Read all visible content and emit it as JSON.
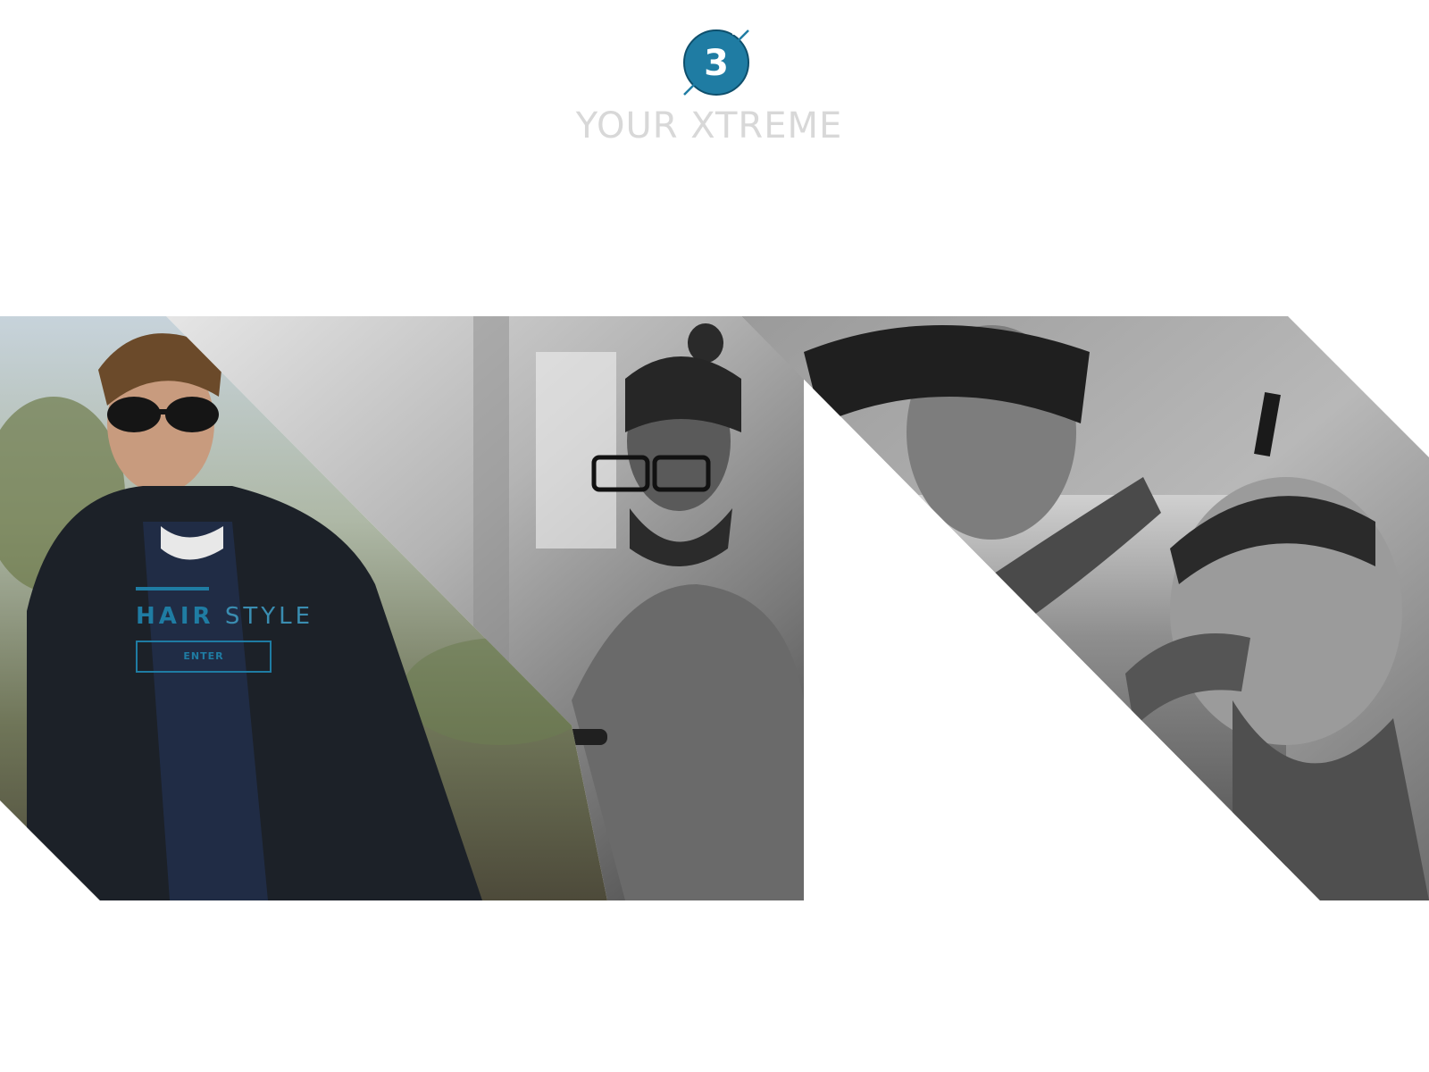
{
  "brand": {
    "logo_number": "3",
    "logo_icon": "circle-number-logo",
    "title": "YOUR XTREME"
  },
  "hero": {
    "panels": [
      {
        "subject": "man-leather-jacket-sunglasses",
        "style": "color"
      },
      {
        "subject": "man-bun-glasses-beard",
        "style": "grayscale"
      },
      {
        "subject": "barber-styling-bearded-client",
        "style": "grayscale"
      }
    ],
    "overlay": {
      "title_bold": "HAIR",
      "title_light": "STYLE",
      "button_label": "ENTER"
    }
  },
  "colors": {
    "accent": "#1f7ca3",
    "brand_title": "#d8d8d8",
    "background": "#ffffff"
  }
}
